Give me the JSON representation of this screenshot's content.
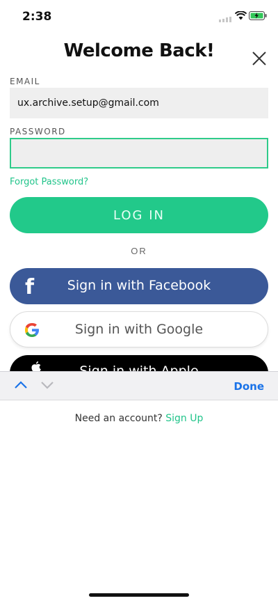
{
  "status": {
    "time": "2:38"
  },
  "header": {
    "title": "Welcome Back!"
  },
  "form": {
    "email_label": "EMAIL",
    "email_value": "ux.archive.setup@gmail.com",
    "password_label": "PASSWORD",
    "password_value": "",
    "forgot_label": "Forgot Password?"
  },
  "buttons": {
    "login": "LOG IN",
    "or": "OR",
    "facebook": "Sign in with Facebook",
    "google": "Sign in with Google",
    "apple": "Sign in with Apple"
  },
  "keyboard_toolbar": {
    "done": "Done"
  },
  "footer": {
    "prompt": "Need an account?",
    "signup": "Sign Up"
  },
  "colors": {
    "accent": "#22c98a",
    "facebook": "#3b5998",
    "done": "#1a73e8"
  },
  "icons": [
    "close-icon",
    "facebook-icon",
    "google-icon",
    "apple-icon",
    "chevron-up-icon",
    "chevron-down-icon",
    "wifi-icon",
    "battery-icon",
    "signal-icon"
  ]
}
